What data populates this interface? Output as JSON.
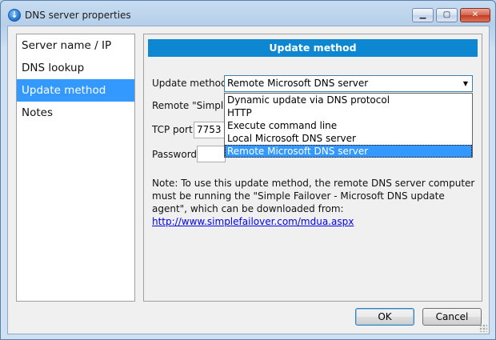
{
  "window": {
    "title": "DNS server properties",
    "app_icon": "failover-app-icon",
    "caption_buttons": {
      "minimize": "▁",
      "maximize": "▢",
      "close": "✕"
    }
  },
  "nav": {
    "items": [
      {
        "label": "Server name / IP",
        "selected": false
      },
      {
        "label": "DNS lookup",
        "selected": false
      },
      {
        "label": "Update method",
        "selected": true
      },
      {
        "label": "Notes",
        "selected": false
      }
    ]
  },
  "panel": {
    "header": "Update method",
    "update_method_label": "Update method:",
    "update_method_value": "Remote Microsoft DNS server",
    "remote_label": "Remote \"Simple",
    "tcp_port_label": "TCP port:",
    "tcp_port_value": "7753",
    "password_label": "Password:",
    "password_value": "",
    "dropdown_options": [
      "Dynamic update via DNS protocol",
      "HTTP",
      "Execute command line",
      "Local Microsoft DNS server",
      "Remote Microsoft DNS server"
    ],
    "dropdown_selected_index": 4,
    "note_text": "Note: To use this update method, the remote DNS server computer must be running the \"Simple Failover - Microsoft DNS update agent\", which can be downloaded from: ",
    "note_link": "http://www.simplefailover.com/mdua.aspx"
  },
  "buttons": {
    "ok": "OK",
    "cancel": "Cancel"
  },
  "colors": {
    "selection": "#3399ff",
    "header_bar": "#0d87d1",
    "link": "#0000ee"
  }
}
